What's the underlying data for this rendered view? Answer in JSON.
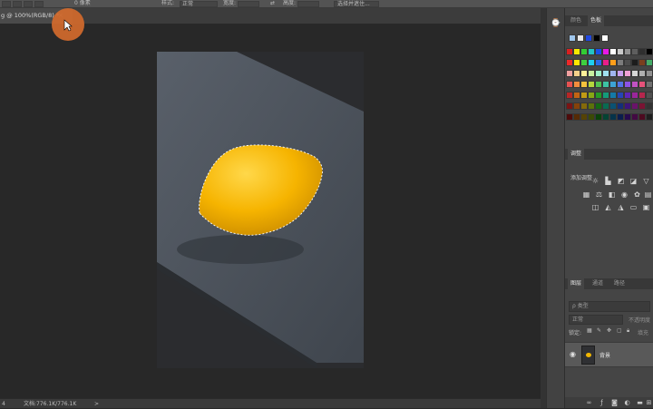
{
  "options_bar": {
    "feather_value": "0 像素",
    "style_label": "样式:",
    "style_value": "正常",
    "width_label": "宽度:",
    "height_label": "高度:",
    "select_mask_button": "选择并遮住..."
  },
  "document_tab": {
    "title": "g @ 100%(RGB/8) *",
    "close_glyph": "×"
  },
  "status_bar": {
    "zoom": "4",
    "doc_info": "文档:776.1K/776.1K",
    "arrow": ">"
  },
  "right_panel": {
    "swatch_tabs": [
      "颜色",
      "色板"
    ],
    "active_swatch_tab": "色板",
    "adjustments_tab": "调整",
    "adjustments_subtitle": "添加调整",
    "layers_tabs": [
      "图层",
      "通道",
      "路径"
    ],
    "layers_search_placeholder": "ρ 类型",
    "blend_mode": "正常",
    "opacity_label": "不透明度",
    "lock_label": "锁定:",
    "fill_label": "填充",
    "layer_name": "背景"
  },
  "swatches": {
    "top_row": [
      "#9fc6ec",
      "#e8e8e8",
      "#2048e0",
      "#000000",
      "#ffffff"
    ],
    "grid": [
      [
        "#d92020",
        "#f5e800",
        "#33cc33",
        "#24c4c4",
        "#1a50e6",
        "#e619e6",
        "#ffffff",
        "#c9c9c9",
        "#8f8f8f",
        "#5e5e5e",
        "#2f2f2f",
        "#000000"
      ],
      [
        "#ee2929",
        "#ffe600",
        "#3fd03f",
        "#1fd0f0",
        "#2a6ae8",
        "#e81e8a",
        "#ff9e1a",
        "#7c7c7c",
        "#4d4d4d",
        "#1c1c1c",
        "#7a3f1e",
        "#44aa66"
      ],
      [
        "#f0a0a0",
        "#f5d08a",
        "#fff099",
        "#c9f0a0",
        "#9ff0c9",
        "#a0e0f0",
        "#a0b5f0",
        "#c9a0f0",
        "#f0a0d6",
        "#d6d6d6",
        "#b0b0b0",
        "#909090"
      ],
      [
        "#e65252",
        "#f28c3d",
        "#f5c23d",
        "#b5d63d",
        "#52c252",
        "#3dc2a3",
        "#3da3d6",
        "#5273e6",
        "#8c52e6",
        "#c252c2",
        "#e6527a",
        "#707070"
      ],
      [
        "#b52626",
        "#c26414",
        "#c29b14",
        "#88a814",
        "#269b26",
        "#149b7a",
        "#147aa8",
        "#2645b5",
        "#5e26b5",
        "#9b269b",
        "#b5264d",
        "#505050"
      ],
      [
        "#7a1414",
        "#85420a",
        "#856a0a",
        "#5c730a",
        "#146a14",
        "#0a6a52",
        "#0a5273",
        "#142e7a",
        "#3d147a",
        "#6a146a",
        "#7a1433",
        "#333333"
      ],
      [
        "#4d0a0a",
        "#552a05",
        "#554305",
        "#3b4a05",
        "#0a430a",
        "#054333",
        "#05334a",
        "#0a1d4d",
        "#270a4d",
        "#430a43",
        "#4d0a20",
        "#1f1f1f"
      ]
    ]
  }
}
